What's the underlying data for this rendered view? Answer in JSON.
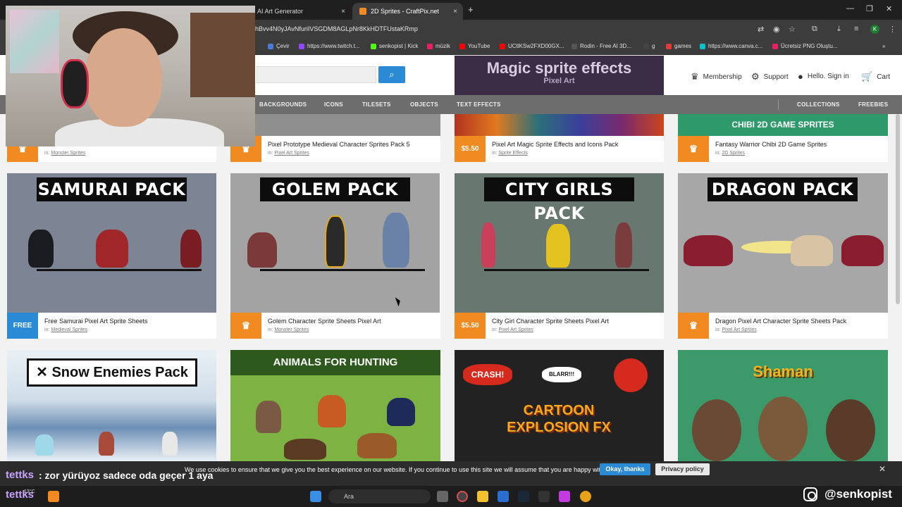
{
  "browser": {
    "tabs": [
      {
        "label": "AI Art Generator",
        "active": false
      },
      {
        "label": "2D Sprites - CraftPix.net",
        "active": true
      }
    ],
    "new_tab_symbol": "+",
    "close_symbol": "×",
    "url": "hBvv4N0yJAvNfuriIVSGDM8AGLpNr8KkHDTFUstaKRmp",
    "bookmarks": [
      {
        "label": "Çevir",
        "icon": "translate-icon",
        "color": "#4b7bd8"
      },
      {
        "label": "https://www.twitch.t...",
        "icon": "twitch-icon",
        "color": "#9146ff"
      },
      {
        "label": "senkopist | Kick",
        "icon": "kick-icon",
        "color": "#53fc18"
      },
      {
        "label": "müzik",
        "icon": "music-icon",
        "color": "#e91e63"
      },
      {
        "label": "YouTube",
        "icon": "youtube-icon",
        "color": "#ff0000"
      },
      {
        "label": "UCtlKSw2FXD00GX...",
        "icon": "youtube-icon",
        "color": "#ff0000"
      },
      {
        "label": "Rodin - Free AI 3D...",
        "icon": "rodin-icon",
        "color": "#222222"
      },
      {
        "label": "g",
        "icon": "kick-icon",
        "color": "#333333"
      },
      {
        "label": "games",
        "icon": "gamepad-icon",
        "color": "#e53935"
      },
      {
        "label": "https://www.canva.c...",
        "icon": "canva-icon",
        "color": "#00c4cc"
      },
      {
        "label": "Ücretsiz PNG Oluştu...",
        "icon": "png-icon",
        "color": "#e91e63"
      }
    ],
    "more_symbol": "»"
  },
  "site": {
    "magic_banner": {
      "title": "Magic sprite effects",
      "subtitle": "Pixel Art"
    },
    "header_links": [
      {
        "label": "Membership",
        "icon": "crown-icon"
      },
      {
        "label": "Support",
        "icon": "support-icon"
      },
      {
        "label": "Hello. Sign in",
        "icon": "user-icon"
      },
      {
        "label": "Cart",
        "icon": "cart-icon"
      }
    ],
    "categories": [
      "BACKGROUNDS",
      "ICONS",
      "TILESETS",
      "OBJECTS",
      "TEXT EFFECTS"
    ],
    "categories_right": [
      "COLLECTIONS",
      "FREEBIES"
    ]
  },
  "top_row": [
    {
      "title": "",
      "category": "Monster Sprites",
      "price": "crown"
    },
    {
      "title": "Pixel Prototype Medieval Character Sprites Pack 5",
      "category": "Pixel Art Sprites",
      "price": "crown"
    },
    {
      "title": "Pixel Art Magic Sprite Effects and Icons Pack",
      "category": "Sprite Effects",
      "price": "$5.50"
    },
    {
      "title": "Fantasy Warrior Chibi 2D Game Sprites",
      "category": "2D Sprites",
      "price": "crown",
      "banner": "CHIBI 2D GAME SPRITES"
    }
  ],
  "cards": [
    {
      "banner": "SAMURAI PACK",
      "title": "Free Samurai Pixel Art Sprite Sheets",
      "category": "Medieval Sprites",
      "price": "FREE",
      "bg": "#7d8595"
    },
    {
      "banner": "GOLEM PACK",
      "title": "Golem Character Sprite Sheets Pixel Art",
      "category": "Monster Sprites",
      "price": "crown",
      "bg": "#a3a3a3"
    },
    {
      "banner": "CITY GIRLS PACK",
      "title": "City Girl Character Sprite Sheets Pixel Art",
      "category": "Pixel Art Sprites",
      "price": "$5.50",
      "bg": "#68776f"
    },
    {
      "banner": "DRAGON PACK",
      "title": "Dragon Pixel Art Character Sprite Sheets Pack",
      "category": "Pixel Art Sprites",
      "price": "crown",
      "bg": "#a7a7a7"
    }
  ],
  "bottom_row": [
    {
      "banner": "Snow Enemies Pack"
    },
    {
      "banner": "ANIMALS FOR HUNTING"
    },
    {
      "banner": "CARTOON EXPLOSION FX",
      "tags": [
        "CRASH!",
        "BLARR!!!"
      ]
    },
    {
      "banner": "Shaman"
    }
  ],
  "in_prefix": "in:",
  "chat": {
    "user": "tettks",
    "message": ": zor yürüyoz sadece oda geçer 1 aya"
  },
  "cookie": {
    "text": "We use cookies to ensure that we give you the best experience on our website. If you continue to use this site we will assume that you are happy with it.",
    "ok": "Okay, thanks",
    "privacy": "Privacy policy"
  },
  "taskbar": {
    "search": "Ara",
    "weather": "13°C",
    "user": "tettks"
  },
  "instagram": "@senkopist",
  "profile_initial": "K",
  "colors": {
    "premium": "#f18b21",
    "free": "#2b8ad6",
    "accent": "#2a8ad4"
  }
}
